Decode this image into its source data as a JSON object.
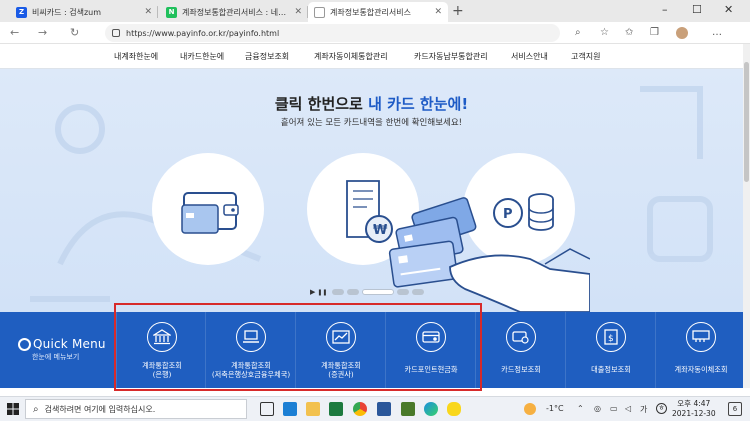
{
  "browser": {
    "tabs": [
      {
        "title": "비씨카드 : 검색zum",
        "favicon": "Z",
        "favicon_color": "#1a5be6",
        "active": false
      },
      {
        "title": "계좌정보통합관리서비스 : 네이버",
        "favicon": "N",
        "favicon_color": "#20c05c",
        "active": false
      },
      {
        "title": "계좌정보통합관리서비스",
        "favicon": "page-icon",
        "favicon_color": "#888888",
        "active": true
      }
    ],
    "url": "https://www.payinfo.or.kr/payinfo.html",
    "new_tab": "+",
    "window_controls": [
      "–",
      "☐",
      "✕"
    ]
  },
  "site_menu": {
    "items": [
      "내계좌한눈에",
      "내카드한눈에",
      "금융정보조회",
      "계좌자동이체통합관리",
      "카드자동납부통합관리",
      "서비스안내",
      "고객지원"
    ]
  },
  "hero": {
    "headline_prefix": "클릭 한번으로 ",
    "headline_highlight": "내 카드 한눈에!",
    "subtext": "흩어져 있는 모든 카드내역을 한번에 확인해보세요!",
    "slide_controls": {
      "play": "▶",
      "pause": "❚❚"
    }
  },
  "quick_menu": {
    "title": "Quick Menu",
    "subtitle": "한눈에 메뉴보기",
    "items": [
      {
        "label_1": "계좌통합조회",
        "label_2": "(은행)",
        "icon": "bank-icon"
      },
      {
        "label_1": "계좌통합조회",
        "label_2": "(저축은행상호금융우체국)",
        "icon": "laptop-icon"
      },
      {
        "label_1": "계좌통합조회",
        "label_2": "(증권사)",
        "icon": "chart-icon"
      },
      {
        "label_1": "카드포인트현금화",
        "label_2": "",
        "icon": "card-icon"
      },
      {
        "label_1": "카드정보조회",
        "label_2": "",
        "icon": "card-search-icon"
      },
      {
        "label_1": "대출정보조회",
        "label_2": "",
        "icon": "document-money-icon"
      },
      {
        "label_1": "계좌자동이체조회",
        "label_2": "",
        "icon": "transfer-icon"
      }
    ]
  },
  "taskbar": {
    "search_placeholder": "검색하려면 여기에 입력하십시오.",
    "temperature": "-1°C",
    "ime": "가",
    "time": "오후 4:47",
    "date": "2021-12-30",
    "notification_count": "6"
  },
  "colors": {
    "accent": "#1e5bc6",
    "quick_menu_bg": "#1f5ec0",
    "hero_bg": "#d6e5f8",
    "highlight_box": "#d72a2a"
  }
}
